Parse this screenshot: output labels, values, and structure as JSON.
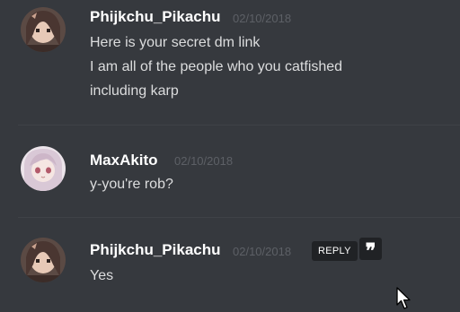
{
  "messages": [
    {
      "username": "Phijkchu_Pikachu",
      "timestamp": "02/10/2018",
      "lines": [
        "Here is your secret dm link",
        "I am all of the people who you catfished",
        "including karp"
      ]
    },
    {
      "username": "MaxAkito",
      "timestamp": "02/10/2018",
      "lines": [
        "y-you're rob?"
      ]
    },
    {
      "username": "Phijkchu_Pikachu",
      "timestamp": "02/10/2018",
      "lines": [
        "Yes"
      ]
    }
  ],
  "actions": {
    "reply_label": "REPLY",
    "quote_glyph": "❞"
  },
  "colors": {
    "background": "#36393e",
    "username": "#ffffff",
    "timestamp": "#5d6066",
    "message_text": "#dcddde",
    "action_bg": "#202225"
  }
}
